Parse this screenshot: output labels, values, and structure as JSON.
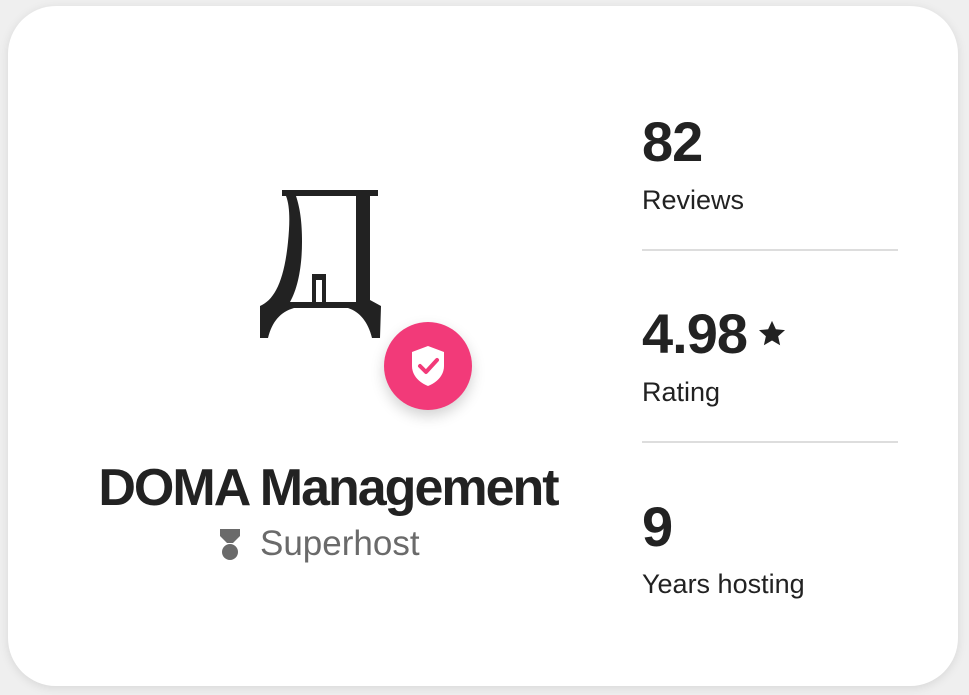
{
  "host": {
    "name": "DOMA Management",
    "badge_label": "Superhost",
    "logo_icon": "cyrillic-de-house-logo",
    "verified_icon": "shield-check-icon",
    "superhost_icon": "superhost-medal-icon",
    "accent_color": "#ff385c"
  },
  "stats": {
    "reviews": {
      "value": "82",
      "label": "Reviews"
    },
    "rating": {
      "value": "4.98",
      "label": "Rating",
      "icon": "star-icon"
    },
    "years": {
      "value": "9",
      "label": "Years hosting"
    }
  }
}
